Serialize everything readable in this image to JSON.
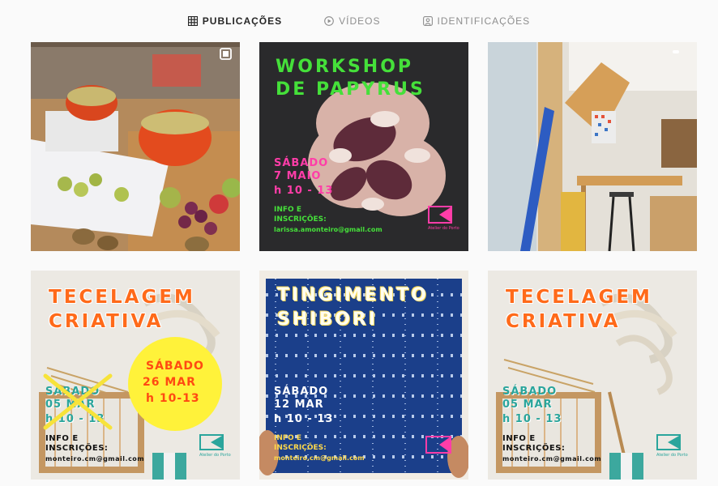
{
  "tabs": [
    {
      "label": "PUBLICAÇÕES",
      "icon": "grid-icon",
      "active": true
    },
    {
      "label": "VÍDEOS",
      "icon": "play-icon",
      "active": false
    },
    {
      "label": "IDENTIFICAÇÕES",
      "icon": "tag-user-icon",
      "active": false
    }
  ],
  "posts": {
    "p2": {
      "title1": "WORKSHOP",
      "title2": "DE PAPYRUS",
      "date1": "SÁBADO",
      "date2": "7 MAIO",
      "time": "h 10 - 13",
      "info1": "INFO E",
      "info2": "INSCRIÇÕES:",
      "email": "larissa.amonteiro@gmail.com",
      "logo": "Atelier do Porto"
    },
    "p4": {
      "title1": "TECELAGEM",
      "title2": "CRIATIVA",
      "circle1": "SÁBADO",
      "circle2": "26 MAR",
      "circle3": "h 10-13",
      "old1": "SÁBADO",
      "old2": "05 MAR",
      "old3": "h 10 - 13",
      "info1": "INFO E",
      "info2": "INSCRIÇÕES:",
      "email": "monteiro.cm@gmail.com",
      "logo": "Atelier do Porto"
    },
    "p5": {
      "title1": "TINGIMENTO",
      "title2": "SHIBORI",
      "date1": "SÁBADO",
      "date2": "12 MAR",
      "time": "h 10 - 13",
      "info1": "INFO E",
      "info2": "INSCRIÇÕES:",
      "email": "monteiro.cm@gmail.com"
    },
    "p6": {
      "title1": "TECELAGEM",
      "title2": "CRIATIVA",
      "date1": "SÁBADO",
      "date2": "05 MAR",
      "time": "h 10 - 13",
      "info1": "INFO E",
      "info2": "INSCRIÇÕES:",
      "email": "monteiro.cm@gmail.com",
      "logo": "Atelier do Porto"
    }
  }
}
